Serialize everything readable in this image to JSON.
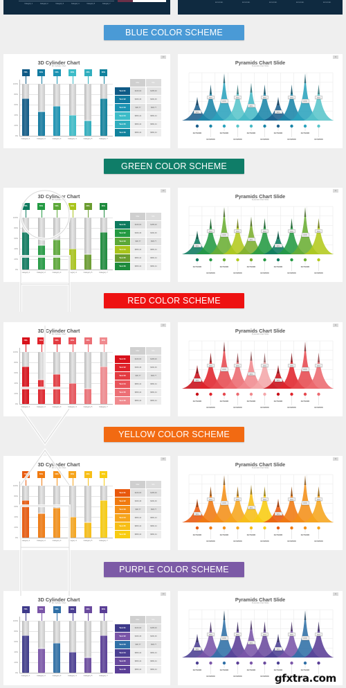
{
  "top_partial": {
    "categories": [
      "Category 1",
      "Category 2",
      "Category 3",
      "Category 4",
      "Category 5",
      "Category 7"
    ],
    "keywords": [
      "KEYWORD",
      "KEYWORD",
      "KEYWORD",
      "KEYWORD",
      "KEYWORD"
    ]
  },
  "schemes": [
    {
      "banner": "BLUE COLOR SCHEME",
      "banner_color": "#4a9ad6",
      "cylinder_slide": {
        "title": "3D Cylinder Chart",
        "subtitle": "3D Cylinder Chart",
        "slide_number": "10",
        "bar_colors": [
          "#0f5a86",
          "#127aa0",
          "#1b93b3",
          "#3cbcc8",
          "#30aebe",
          "#11829d"
        ],
        "table_colors": [
          "#0f5a86",
          "#127aa0",
          "#1b93b3",
          "#3cbcc8",
          "#30aebe",
          "#11829d"
        ]
      },
      "pyramid_slide": {
        "title": "Pyramids Chart Slide",
        "subtitle": "Pyramids Chart Slide",
        "slide_number": "11",
        "colors": [
          "#1c5f8c",
          "#1a85a8",
          "#2ba3bd",
          "#59c5cb",
          "#47bac6",
          "#1a85a8",
          "#1c5f8c",
          "#1a85a8",
          "#2ba3bd",
          "#59c5cb"
        ]
      }
    },
    {
      "banner": "GREEN COLOR SCHEME",
      "banner_color": "#0f7d68",
      "cylinder_slide": {
        "title": "3D Cylinder Chart",
        "subtitle": "3D Cylinder Chart",
        "slide_number": "10",
        "bar_colors": [
          "#0d7a5e",
          "#239a42",
          "#5ca838",
          "#a9c41b",
          "#6a9c2f",
          "#1d8b3c"
        ],
        "table_colors": [
          "#0d7a5e",
          "#239a42",
          "#5ca838",
          "#a9c41b",
          "#6a9c2f",
          "#1d8b3c"
        ]
      },
      "pyramid_slide": {
        "title": "Pyramids Chart Slide",
        "subtitle": "Pyramids Chart Slide",
        "slide_number": "11",
        "colors": [
          "#0d7a5e",
          "#239a42",
          "#6aae33",
          "#b3ca1c",
          "#7cae2f",
          "#239a42",
          "#0d7a5e",
          "#239a42",
          "#6aae33",
          "#b3ca1c"
        ]
      }
    },
    {
      "banner": "RED COLOR SCHEME",
      "banner_color": "#ee1111",
      "cylinder_slide": {
        "title": "3D Cylinder Chart",
        "subtitle": "3D Cylinder Chart",
        "slide_number": "10",
        "bar_colors": [
          "#d8101a",
          "#e0232b",
          "#e33a40",
          "#e8535a",
          "#ec6f75",
          "#f08a8e"
        ],
        "table_colors": [
          "#d8101a",
          "#e0232b",
          "#e33a40",
          "#e8535a",
          "#ec6f75",
          "#f08a8e"
        ]
      },
      "pyramid_slide": {
        "title": "Pyramids Chart Slide",
        "subtitle": "Pyramids Chart Slide",
        "slide_number": "11",
        "colors": [
          "#c80f18",
          "#e0232b",
          "#e64a50",
          "#ec6a70",
          "#f08a8e",
          "#f4a7aa",
          "#c80f18",
          "#e0232b",
          "#e64a50",
          "#ec6a70"
        ]
      }
    },
    {
      "banner": "YELLOW COLOR SCHEME",
      "banner_color": "#f26a12",
      "cylinder_slide": {
        "title": "3D Cylinder Chart",
        "subtitle": "3D Cylinder Chart",
        "slide_number": "10",
        "bar_colors": [
          "#e8580c",
          "#f07a10",
          "#f49018",
          "#f6a51c",
          "#f7be16",
          "#f8cc10"
        ],
        "table_colors": [
          "#e8580c",
          "#f07a10",
          "#f49018",
          "#f6a51c",
          "#f7be16",
          "#f8cc10"
        ]
      },
      "pyramid_slide": {
        "title": "Pyramids Chart Slide",
        "subtitle": "Pyramids Chart Slide",
        "slide_number": "11",
        "colors": [
          "#e8580c",
          "#f07a10",
          "#f49018",
          "#f6a51c",
          "#f7be16",
          "#f8cc10",
          "#e8580c",
          "#f07a10",
          "#f49018",
          "#f6a51c"
        ]
      }
    },
    {
      "banner": "PURPLE COLOR SCHEME",
      "banner_color": "#7c5aa6",
      "cylinder_slide": {
        "title": "3D Cylinder Chart",
        "subtitle": "3D Cylinder Chart",
        "slide_number": "10",
        "bar_colors": [
          "#3e3a8a",
          "#7a55a8",
          "#2f6fa6",
          "#4b3f92",
          "#6a4a9e",
          "#5a3e96"
        ],
        "table_colors": [
          "#3e3a8a",
          "#7a55a8",
          "#2f6fa6",
          "#4b3f92",
          "#6a4a9e",
          "#5a3e96"
        ]
      },
      "pyramid_slide": {
        "title": "Pyramids Chart Slide",
        "subtitle": "Pyramids Chart Slide",
        "slide_number": "11",
        "colors": [
          "#4b3f92",
          "#7a55a8",
          "#2f6fa6",
          "#5a3e96",
          "#7a55a8",
          "#6a4a9e",
          "#4b3f92",
          "#7a55a8",
          "#2f6fa6",
          "#5a3e96"
        ]
      }
    }
  ],
  "chart_data": [
    {
      "type": "bar",
      "title": "3D Cylinder Chart",
      "subtitle": "3D Cylinder Chart",
      "categories": [
        "Category 1",
        "Category 2",
        "Category 3",
        "Category 4",
        "Category 5",
        "Category 7"
      ],
      "values": [
        70,
        50,
        50,
        30,
        20,
        80
      ],
      "fill_levels": [
        72,
        47,
        57,
        40,
        30,
        72
      ],
      "value_labels": [
        "70%",
        "50%",
        "50%",
        "30%",
        "20%",
        "80%"
      ],
      "yticks": [
        "0%",
        "20%",
        "40%",
        "60%",
        "80%",
        "100%"
      ],
      "ylim": [
        0,
        100
      ],
      "grid": true
    },
    {
      "type": "table",
      "columns": [
        "",
        "Max",
        "Min"
      ],
      "rows": [
        [
          "Text 01",
          "$169,00",
          "$185,00"
        ],
        [
          "Text 02",
          "$369,46",
          "$390,46"
        ],
        [
          "Text 03",
          "$90,77",
          "$98,77"
        ],
        [
          "Text 04",
          "$869,44",
          "$890,44"
        ],
        [
          "Text 05",
          "$869,44",
          "$890,44"
        ],
        [
          "Text 06",
          "$869,44",
          "$890,44"
        ]
      ]
    },
    {
      "type": "area",
      "title": "Pyramids Chart Slide",
      "subtitle": "Pyramids Chart Slide",
      "categories": [
        "KEYWORD",
        "KEYWORD",
        "KEYWORD",
        "KEYWORD",
        "KEYWORD",
        "KEYWORD",
        "KEYWORD",
        "KEYWORD",
        "KEYWORD",
        "KEYWORD"
      ],
      "values": [
        50,
        90,
        100,
        90,
        80,
        90,
        50,
        90,
        100,
        90
      ],
      "value_labels": [
        "50%",
        "90%",
        "100%",
        "90%",
        "80%",
        "90%",
        "50%",
        "90%",
        "100%",
        "90%"
      ],
      "ylim": [
        0,
        100
      ],
      "grid": true
    }
  ]
}
